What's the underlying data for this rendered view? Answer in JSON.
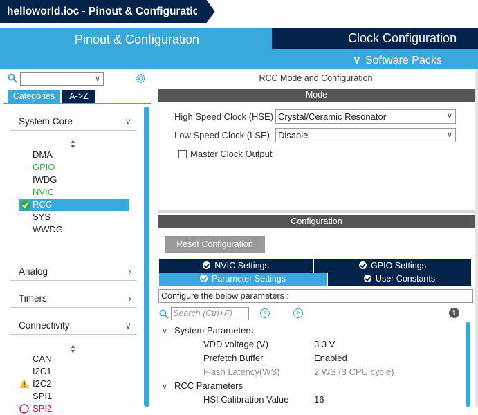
{
  "breadcrumb": {
    "file": "helloworld.ioc - Pinout & Configuration"
  },
  "top_tabs": {
    "pinout": "Pinout & Configuration",
    "clock": "Clock Configuration",
    "software_packs": "Software Packs"
  },
  "left": {
    "tab_categories": "Categories",
    "tab_az": "A->Z",
    "categories": {
      "system_core": "System Core",
      "analog": "Analog",
      "timers": "Timers",
      "connectivity": "Connectivity"
    },
    "system_core_items": [
      "DMA",
      "GPIO",
      "IWDG",
      "NVIC",
      "RCC",
      "SYS",
      "WWDG"
    ],
    "connectivity_items": [
      "CAN",
      "I2C1",
      "I2C2",
      "SPI1",
      "SPI2"
    ]
  },
  "right": {
    "title": "RCC Mode and Configuration",
    "mode_header": "Mode",
    "hse_label": "High Speed Clock (HSE)",
    "hse_value": "Crystal/Ceramic Resonator",
    "lse_label": "Low Speed Clock (LSE)",
    "lse_value": "Disable",
    "mco_label": "Master Clock Output",
    "config_header": "Configuration",
    "reset_button": "Reset Configuration",
    "tabs": {
      "nvic": "NVIC Settings",
      "gpio": "GPIO Settings",
      "parameter": "Parameter Settings",
      "user_constants": "User Constants"
    },
    "configure_hint": "Configure the below parameters :",
    "search_placeholder": "Search (Ctrl+F)",
    "groups": {
      "system_params": "System Parameters",
      "rcc_params": "RCC Parameters"
    },
    "params": {
      "vdd_name": "VDD voltage (V)",
      "vdd_value": "3.3 V",
      "prefetch_name": "Prefetch Buffer",
      "prefetch_value": "Enabled",
      "flash_name": "Flash Latency(WS)",
      "flash_value": "2 WS (3 CPU cycle)",
      "hsi_name": "HSI Calibration Value",
      "hsi_value": "16"
    }
  },
  "colors": {
    "navy": "#03234b",
    "accent": "#39a9dc",
    "green": "#3ca83c",
    "warning": "#f0c419"
  }
}
